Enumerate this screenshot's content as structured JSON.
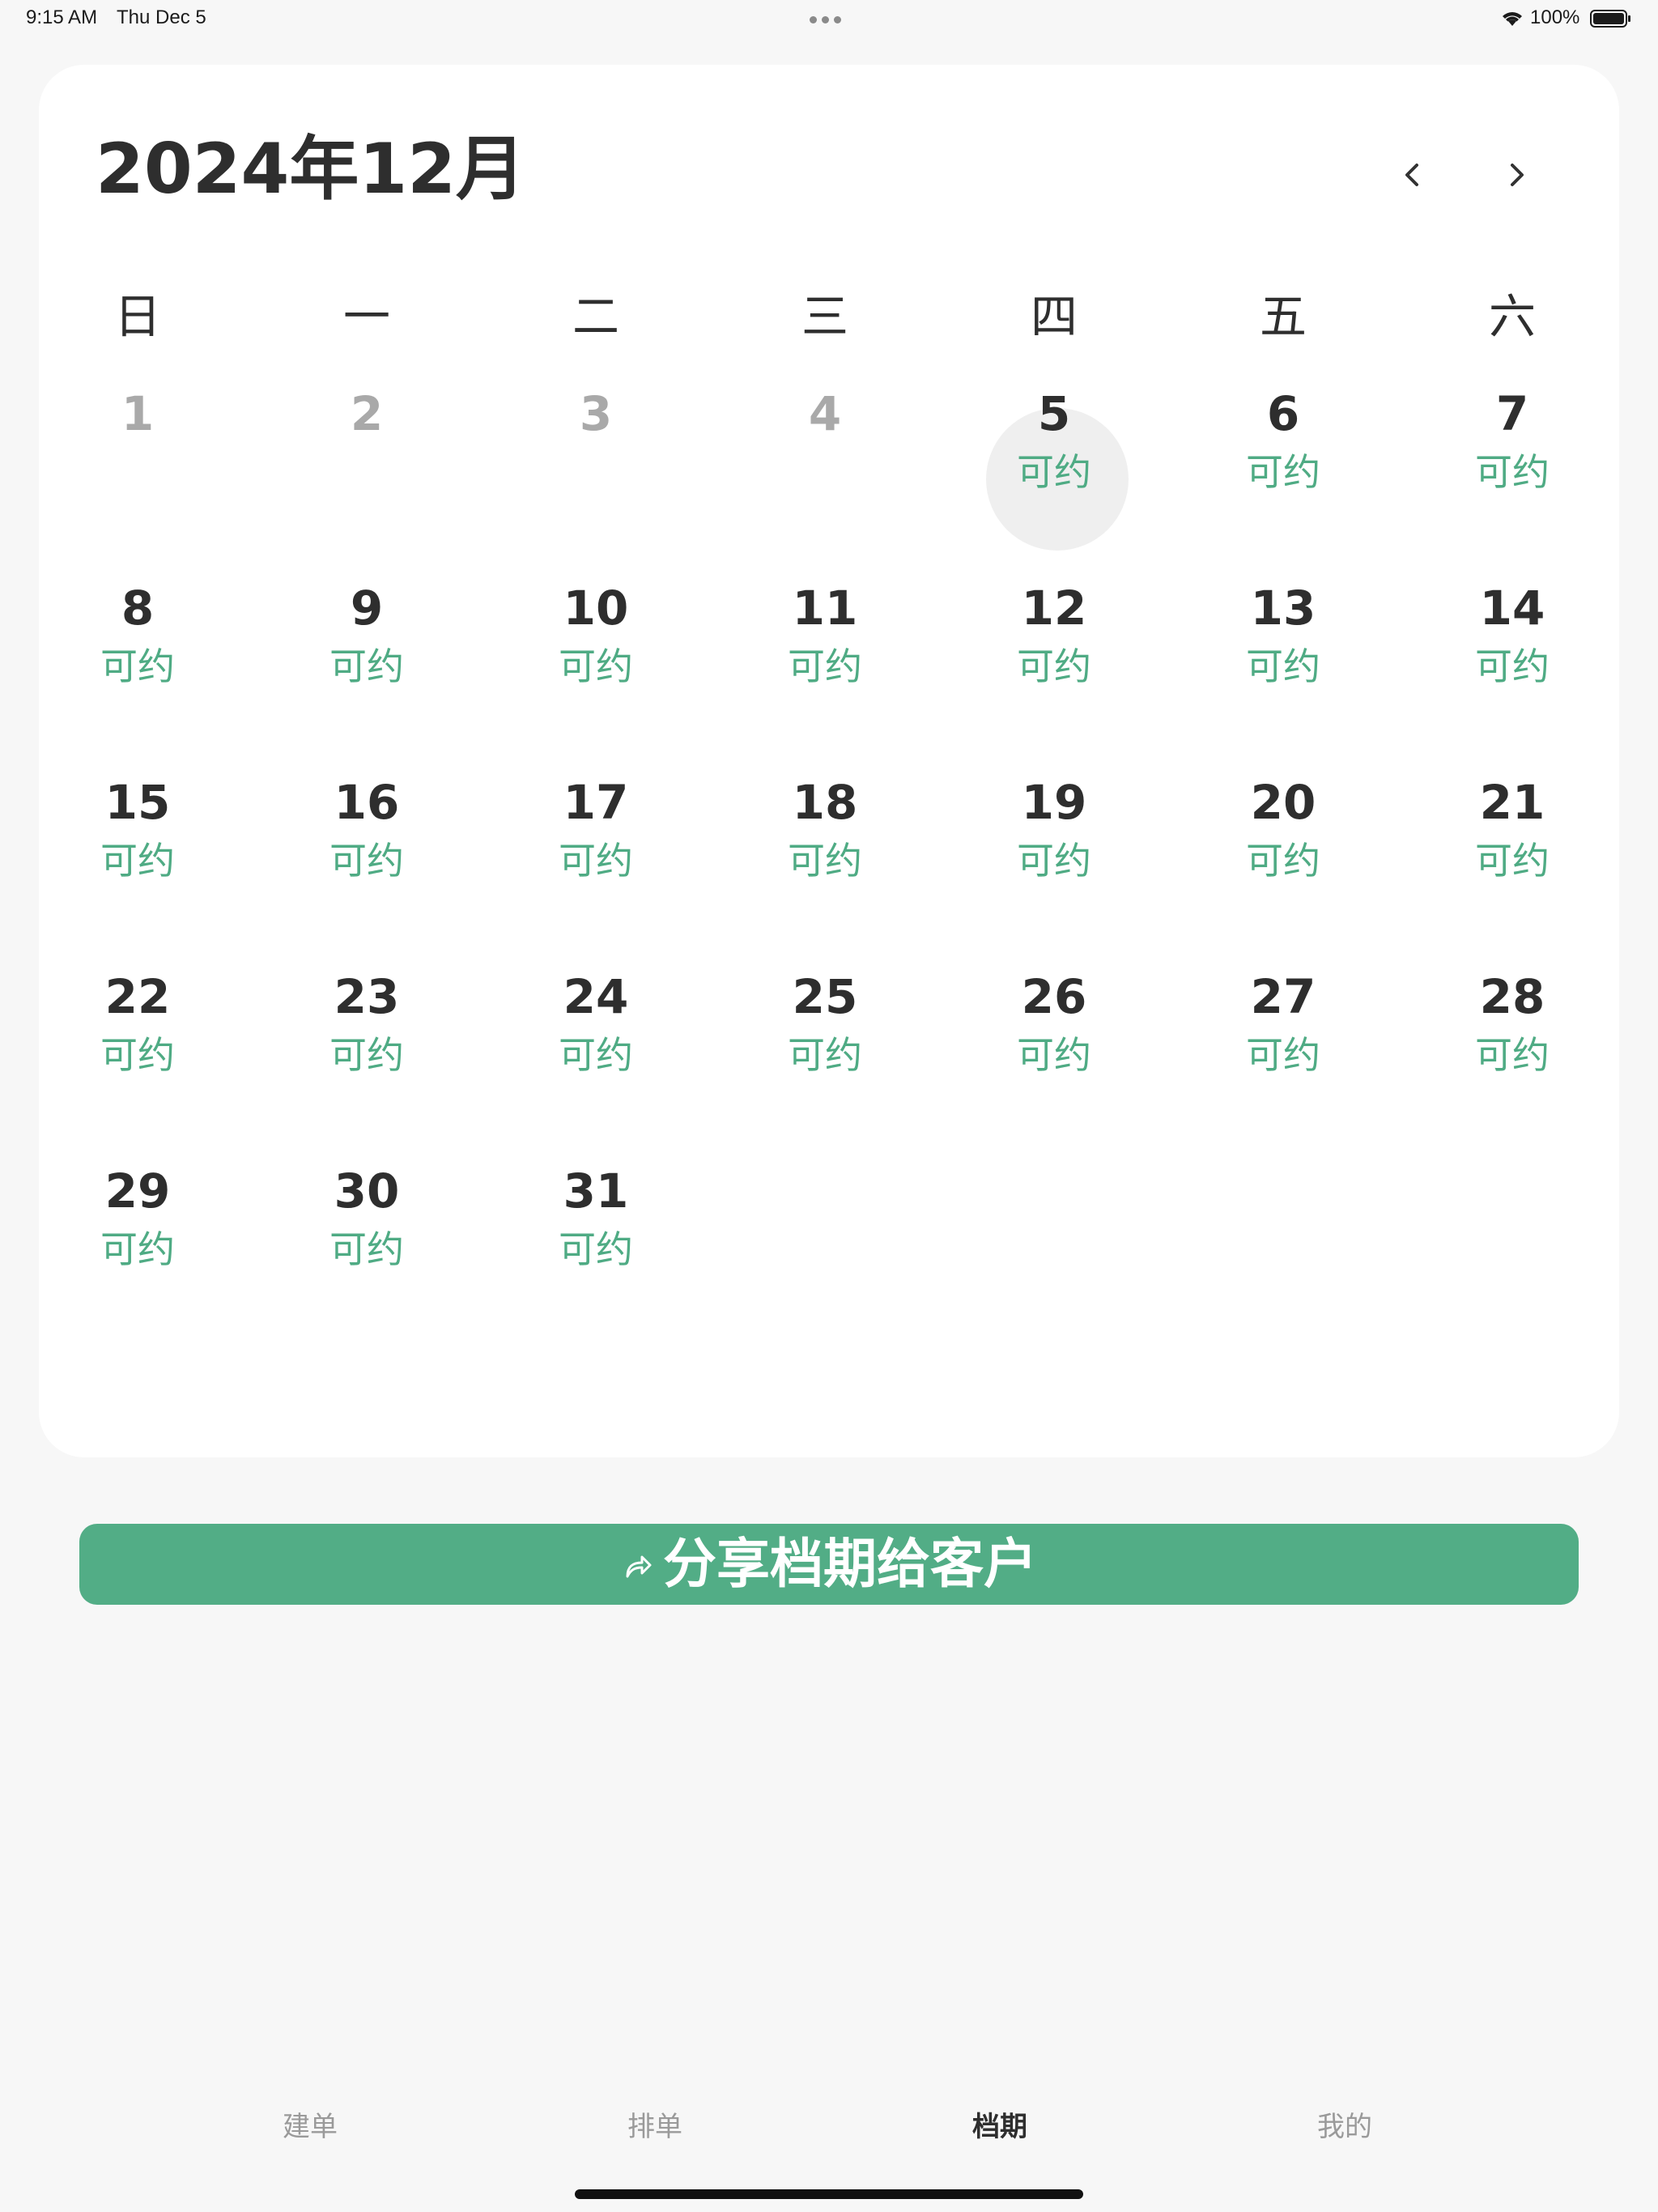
{
  "status_bar": {
    "time": "9:15 AM",
    "date": "Thu Dec 5",
    "battery": "100%",
    "icons": [
      "multitask-dots-icon",
      "wifi-icon",
      "battery-icon"
    ]
  },
  "calendar": {
    "title": "2024年12月",
    "weekdays": [
      "日",
      "一",
      "二",
      "三",
      "四",
      "五",
      "六"
    ],
    "today": "5",
    "available_color": "#4fab84",
    "days": [
      {
        "num": "1",
        "status": ""
      },
      {
        "num": "2",
        "status": ""
      },
      {
        "num": "3",
        "status": ""
      },
      {
        "num": "4",
        "status": ""
      },
      {
        "num": "5",
        "status": "可约"
      },
      {
        "num": "6",
        "status": "可约"
      },
      {
        "num": "7",
        "status": "可约"
      },
      {
        "num": "8",
        "status": "可约"
      },
      {
        "num": "9",
        "status": "可约"
      },
      {
        "num": "10",
        "status": "可约"
      },
      {
        "num": "11",
        "status": "可约"
      },
      {
        "num": "12",
        "status": "可约"
      },
      {
        "num": "13",
        "status": "可约"
      },
      {
        "num": "14",
        "status": "可约"
      },
      {
        "num": "15",
        "status": "可约"
      },
      {
        "num": "16",
        "status": "可约"
      },
      {
        "num": "17",
        "status": "可约"
      },
      {
        "num": "18",
        "status": "可约"
      },
      {
        "num": "19",
        "status": "可约"
      },
      {
        "num": "20",
        "status": "可约"
      },
      {
        "num": "21",
        "status": "可约"
      },
      {
        "num": "22",
        "status": "可约"
      },
      {
        "num": "23",
        "status": "可约"
      },
      {
        "num": "24",
        "status": "可约"
      },
      {
        "num": "25",
        "status": "可约"
      },
      {
        "num": "26",
        "status": "可约"
      },
      {
        "num": "27",
        "status": "可约"
      },
      {
        "num": "28",
        "status": "可约"
      },
      {
        "num": "29",
        "status": "可约"
      },
      {
        "num": "30",
        "status": "可约"
      },
      {
        "num": "31",
        "status": "可约"
      }
    ]
  },
  "share_button": {
    "label": "分享档期给客户",
    "icon": "share-icon",
    "color": "#52ad86"
  },
  "tab_bar": {
    "tabs": [
      {
        "label": "建单",
        "active": false
      },
      {
        "label": "排单",
        "active": false
      },
      {
        "label": "档期",
        "active": true
      },
      {
        "label": "我的",
        "active": false
      }
    ]
  }
}
